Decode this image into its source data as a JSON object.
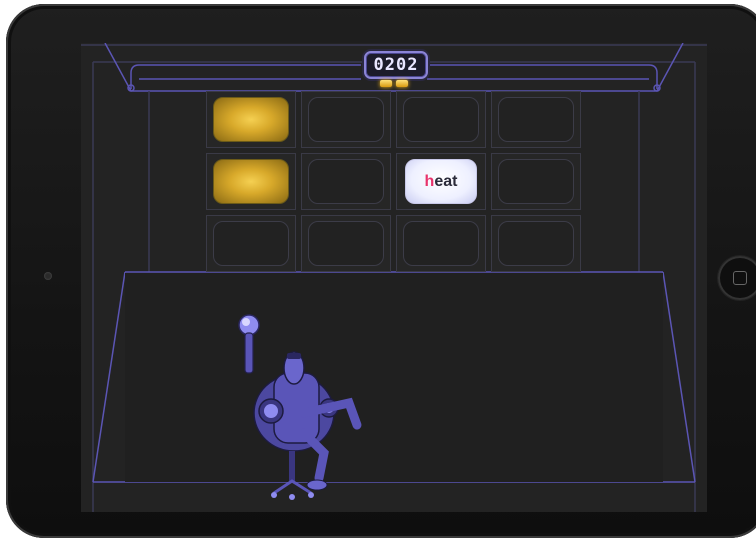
{
  "game": {
    "score": "0202",
    "lights": 2,
    "tiles": [
      {
        "row": 1,
        "col": 1,
        "state": "gold"
      },
      {
        "row": 1,
        "col": 2,
        "state": "empty"
      },
      {
        "row": 1,
        "col": 3,
        "state": "empty"
      },
      {
        "row": 1,
        "col": 4,
        "state": "empty"
      },
      {
        "row": 2,
        "col": 1,
        "state": "gold"
      },
      {
        "row": 2,
        "col": 2,
        "state": "empty"
      },
      {
        "row": 2,
        "col": 3,
        "state": "word",
        "first": "h",
        "rest": "eat"
      },
      {
        "row": 2,
        "col": 4,
        "state": "empty"
      },
      {
        "row": 3,
        "col": 1,
        "state": "empty"
      },
      {
        "row": 3,
        "col": 2,
        "state": "empty"
      },
      {
        "row": 3,
        "col": 3,
        "state": "empty"
      },
      {
        "row": 3,
        "col": 4,
        "state": "empty"
      }
    ]
  },
  "colors": {
    "outline": "#5b55b4",
    "gold": "#e8b832",
    "highlight_letter": "#e8336c",
    "character": "#5a55b8"
  }
}
